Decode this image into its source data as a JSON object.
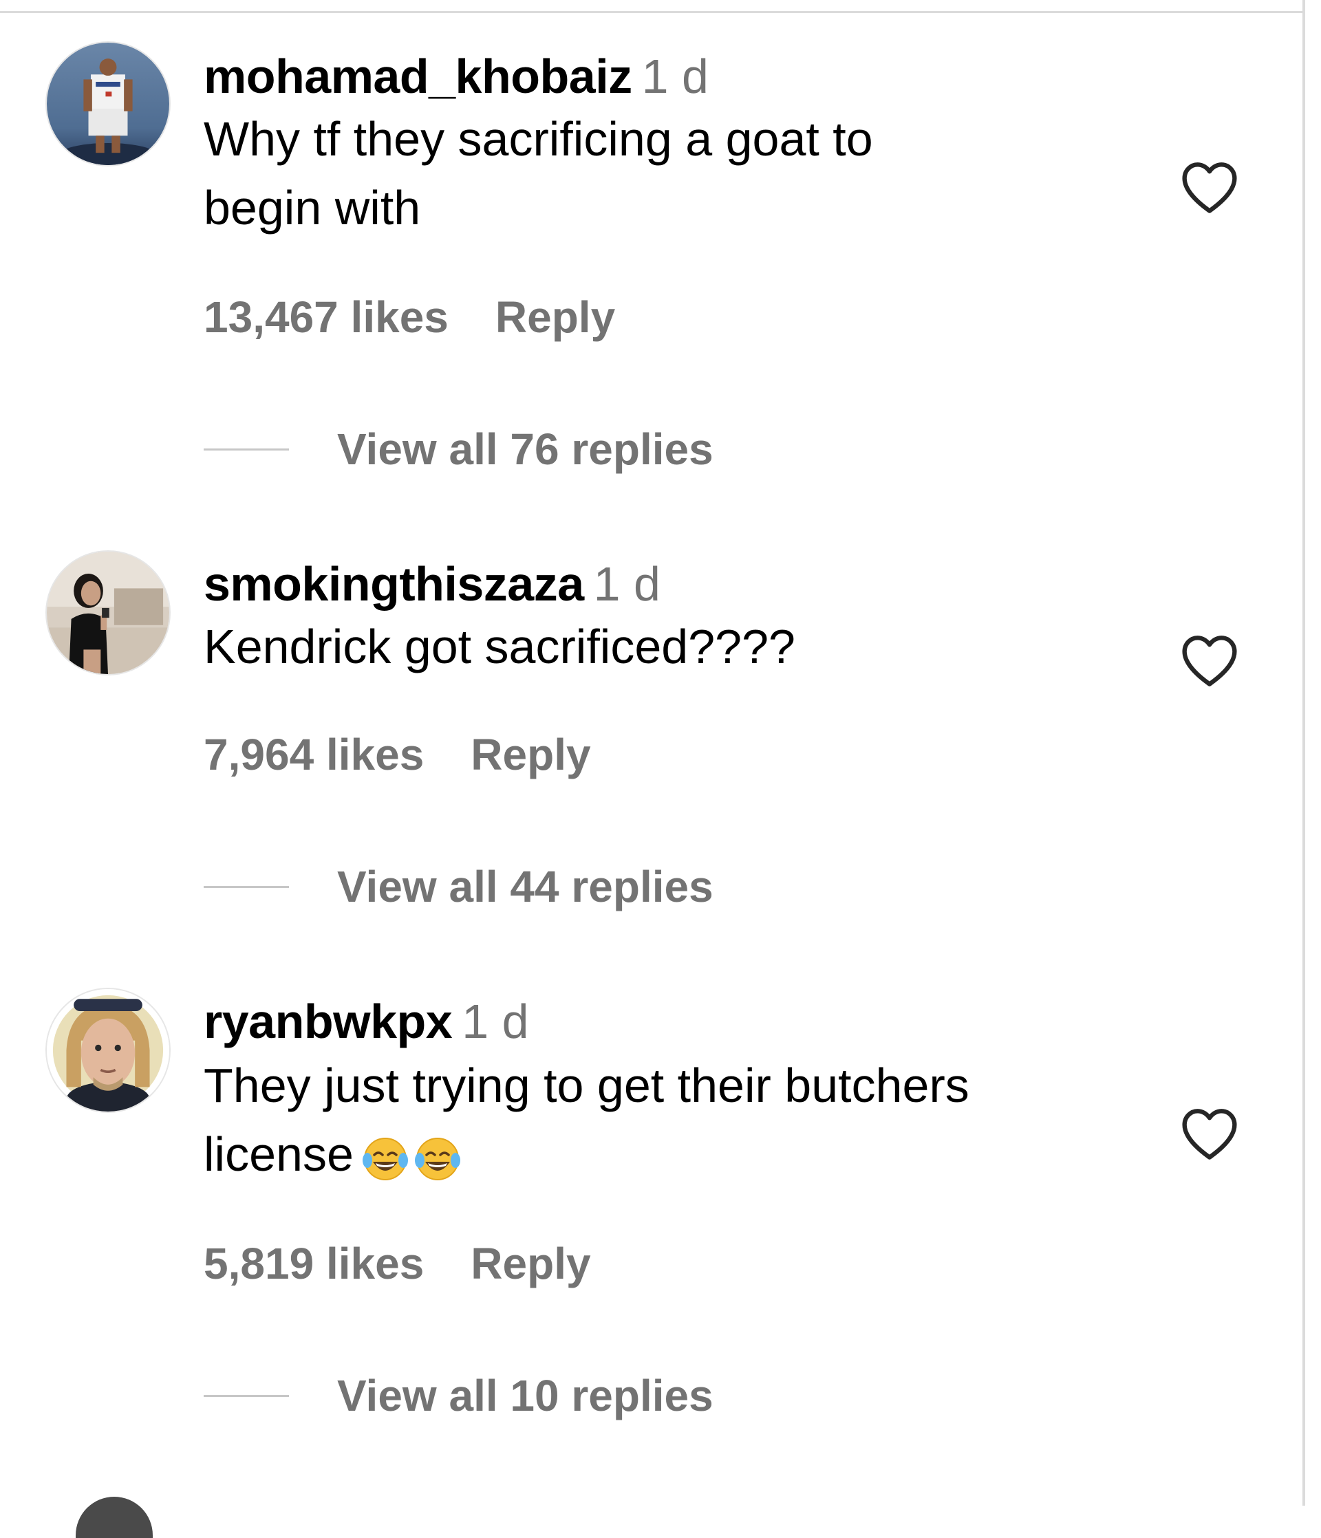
{
  "comments": [
    {
      "username": "mohamad_khobaiz",
      "time": "1 d",
      "text_lines": [
        "Why tf they sacrificing a goat to",
        "begin with"
      ],
      "likes": "13,467 likes",
      "reply_label": "Reply",
      "view_replies": "View all 76 replies",
      "avatar_desc": "basketball-player-avatar"
    },
    {
      "username": "smokingthiszaza",
      "time": "1 d",
      "text_lines": [
        "Kendrick got sacrificed????"
      ],
      "likes": "7,964 likes",
      "reply_label": "Reply",
      "view_replies": "View all 44 replies",
      "avatar_desc": "person-selfie-avatar"
    },
    {
      "username": "ryanbwkpx",
      "time": "1 d",
      "text_lines": [
        "They just trying to get their butchers",
        "license"
      ],
      "emoji": "😂😂",
      "likes": "5,819 likes",
      "reply_label": "Reply",
      "view_replies": "View all 10 replies",
      "avatar_desc": "man-face-avatar"
    }
  ],
  "colors": {
    "secondary_text": "#737373",
    "divider": "#dbdbdb",
    "primary_text": "#000000"
  },
  "icons": {
    "like": "heart-outline-icon"
  }
}
